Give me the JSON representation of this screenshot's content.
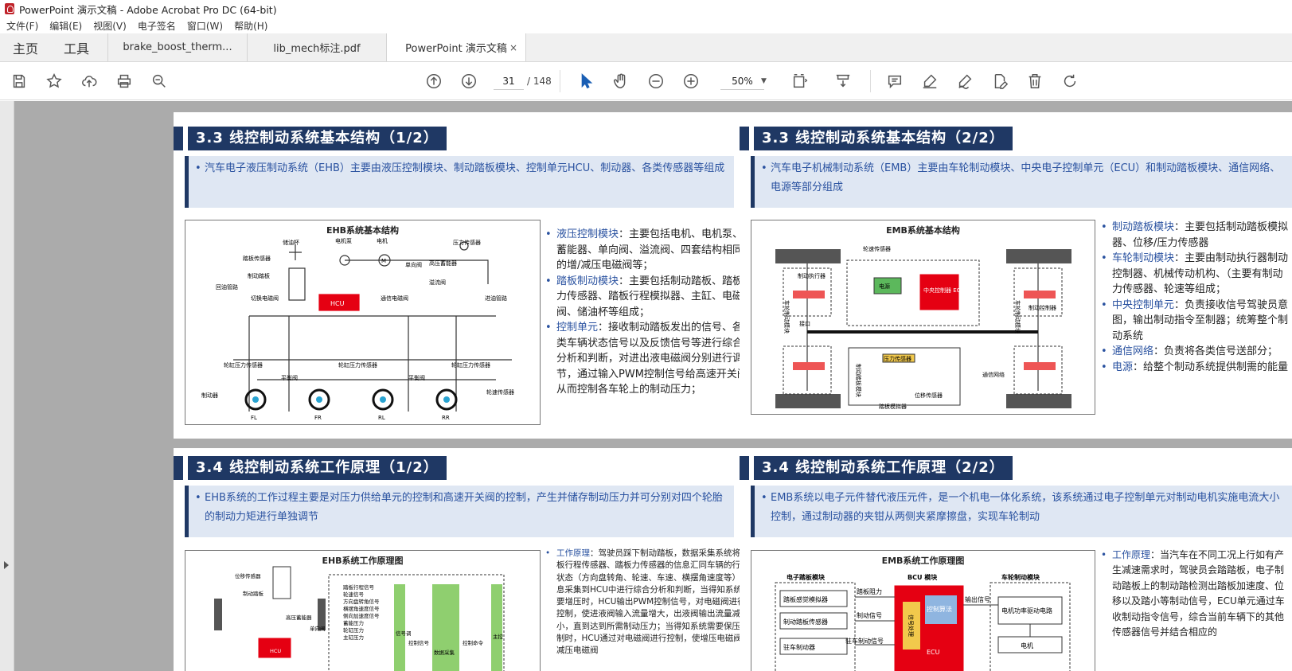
{
  "window": {
    "title": "PowerPoint 演示文稿 - Adobe Acrobat Pro DC (64-bit)"
  },
  "menu": [
    "文件(F)",
    "编辑(E)",
    "视图(V)",
    "电子签名",
    "窗口(W)",
    "帮助(H)"
  ],
  "home_tabs": {
    "home": "主页",
    "tools": "工具"
  },
  "doc_tabs": [
    {
      "label": "brake_boost_therm..."
    },
    {
      "label": "lib_mech标注.pdf"
    },
    {
      "label": "PowerPoint 演示文稿",
      "close": "×"
    }
  ],
  "toolbar": {
    "page_current": "31",
    "page_total": "/ 148",
    "zoom": "50%"
  },
  "icons": [
    "save-icon",
    "bookmark-star-icon",
    "upload-icon",
    "print-icon",
    "search-zoom-icon",
    "page-up-icon",
    "page-down-icon",
    "select-cursor-icon",
    "hand-icon",
    "zoom-out-icon",
    "zoom-in-icon",
    "fit-page-icon",
    "scroll-mode-icon",
    "comment-icon",
    "highlight-icon",
    "sign-icon",
    "edit-icon",
    "delete-icon",
    "rotate-icon"
  ],
  "slides": {
    "s1": {
      "title": "3.3 线控制动系统基本结构（1/2）",
      "summary": "汽车电子液压制动系统（EHB）主要由液压控制模块、制动踏板模块、控制单元HCU、制动器、各类传感器等组成",
      "diagram_title": "EHB系统基本结构",
      "diagram_labels": {
        "hcu": "HCU",
        "reservoir": "储油杯",
        "motor_pump": "电机泵",
        "motor": "电机",
        "m": "M",
        "pressure_sensor": "压力传感器",
        "pedal_sensor": "踏板传感器",
        "pedal": "制动踏板",
        "return_line": "回油管路",
        "switch_valve": "切换电磁阀",
        "high_accum": "高压蓄能器",
        "check_valve": "单向阀",
        "relief_valve": "溢流阀",
        "channel_valve": "通信电磁阀",
        "inlet_line": "进油管路",
        "balance_valve_1": "平衡阀",
        "balance_valve_2": "平衡阀",
        "wheel_sensor_1": "轮缸压力传感器",
        "wheel_sensor_2": "轮缸压力传感器",
        "wheel_sensor_3": "轮缸压力传感器",
        "brake": "制动器",
        "speed_sensor": "轮速传感器",
        "FL": "FL",
        "FR": "FR",
        "RL": "RL",
        "RR": "RR"
      },
      "bullets": [
        {
          "key": "液压控制模块",
          "text": "：主要包括电机、电机泵、蓄能器、单向阀、溢流阀、四套结构相同的增/减压电磁阀等；"
        },
        {
          "key": "踏板制动模块",
          "text": "：主要包括制动踏板、踏板力传感器、踏板行程模拟器、主缸、电磁阀、储油杯等组成；"
        },
        {
          "key": "控制单元",
          "text": "：接收制动踏板发出的信号、各类车辆状态信号以及反馈信号等进行综合分析和判断，对进出液电磁阀分别进行调节，通过输入PWM控制信号给高速开关阀从而控制各车轮上的制动压力；"
        }
      ]
    },
    "s2": {
      "title": "3.3 线控制动系统基本结构（2/2）",
      "summary": "汽车电子机械制动系统（EMB）主要由车轮制动模块、中央电子控制单元（ECU）和制动踏板模块、通信网络、电源等部分组成",
      "diagram_title": "EMB系统基本结构",
      "diagram_labels": {
        "ecu": "中央控制器 ECU",
        "power": "电源",
        "wheel_speed": "轮速传感器",
        "interface": "接口",
        "actuator": "制动执行器",
        "controller": "制动控制器",
        "module_left": "车轮制动模块",
        "module_right": "车轮制动模块",
        "pedal_box": "制动踏板模块",
        "pressure": "压力传感器",
        "position": "位移传感器",
        "emulator": "踏板模拟器",
        "network": "通信网络"
      },
      "bullets": [
        {
          "key": "制动踏板模块",
          "text": "：主要包括制动踏板模拟器、位移/压力传感器"
        },
        {
          "key": "车轮制动模块",
          "text": "：主要由制动执行器制动控制器、机械传动机构、（主要有制动力传感器、轮速等组成；"
        },
        {
          "key": "中央控制单元",
          "text": "：负责接收信号驾驶员意图，输出制动指令至制器；统筹整个制动系统"
        },
        {
          "key": "通信网络",
          "text": "：负责将各类信号送部分；"
        },
        {
          "key": "电源",
          "text": "：给整个制动系统提供制需的能量"
        }
      ]
    },
    "s3": {
      "title": "3.4 线控制动系统工作原理（1/2）",
      "summary": "EHB系统的工作过程主要是对压力供给单元的控制和高速开关阀的控制，产生并储存制动压力并可分别对四个轮胎的制动力矩进行单独调节",
      "diagram_title": "EHB系统工作原理图",
      "diagram_labels": {
        "hcu": "HCU",
        "disp_sensor": "位移传感器",
        "pedal": "制动踏板",
        "high_accum": "高压蓄能器",
        "check_valve": "单向阀",
        "sig1": "踏板行程信号",
        "sig2": "轮速信号",
        "sig3": "方向盘转角信号",
        "sig4": "横摆角速度信号",
        "sig5": "侧向加速度信号",
        "sig6": "蓄能压力",
        "sig7": "轮缸压力",
        "sig8": "主缸压力",
        "col1": "信号调",
        "col2": "数据采集",
        "col3": "主控",
        "arrow1": "控制信号",
        "arrow2": "控制命令"
      },
      "bullets": [
        {
          "key": "工作原理",
          "text": "：驾驶员踩下制动踏板，数据采集系统将踏板行程传感器、踏板力传感器的信息汇同车辆的行驶状态（方向盘转角、轮速、车速、横摆角速度等）信息采集到HCU中进行综合分析和判断，当得知系统需要增压时，HCU输出PWM控制信号，对电磁阀进行控制，使进液阀输入流量增大，出液阀输出流量减小，直到达到所需制动压力；当得知系统需要保压控制时，HCU通过对电磁阀进行控制，使增压电磁阀和减压电磁阀"
        }
      ]
    },
    "s4": {
      "title": "3.4 线控制动系统工作原理（2/2）",
      "summary": "EMB系统以电子元件替代液压元件，是一个机电一体化系统，该系统通过电子控制单元对制动电机实施电流大小控制，通过制动器的夹钳从两侧夹紧摩擦盘，实现车轮制动",
      "diagram_title": "EMB系统工作原理图",
      "diagram_labels": {
        "pedal_module": "电子踏板模块",
        "bcu_module": "BCU 模块",
        "wheel_module": "车轮制动模块",
        "emulator": "踏板感觉模拟器",
        "pedal_sensor": "制动踏板传感器",
        "park": "驻车制动器",
        "resistance": "踏板阻力",
        "brake_sig": "制动信号",
        "park_sig": "驻车制动信号",
        "signal": "信号处理",
        "ctrl": "控制算法",
        "ecu": "ECU",
        "out_sig": "输出信号",
        "driver": "电机功率驱动电路",
        "motor": "电机"
      },
      "bullets": [
        {
          "key": "工作原理",
          "text": "：当汽车在不同工况上行如有产生减速需求时，驾驶员会踏踏板，电子制动踏板上的制动踏检测出踏板加速度、位移以及踏小等制动信号，ECU单元通过车收制动指令信号，综合当前车辆下的其他传感器信号并结合相应的"
        }
      ]
    }
  }
}
